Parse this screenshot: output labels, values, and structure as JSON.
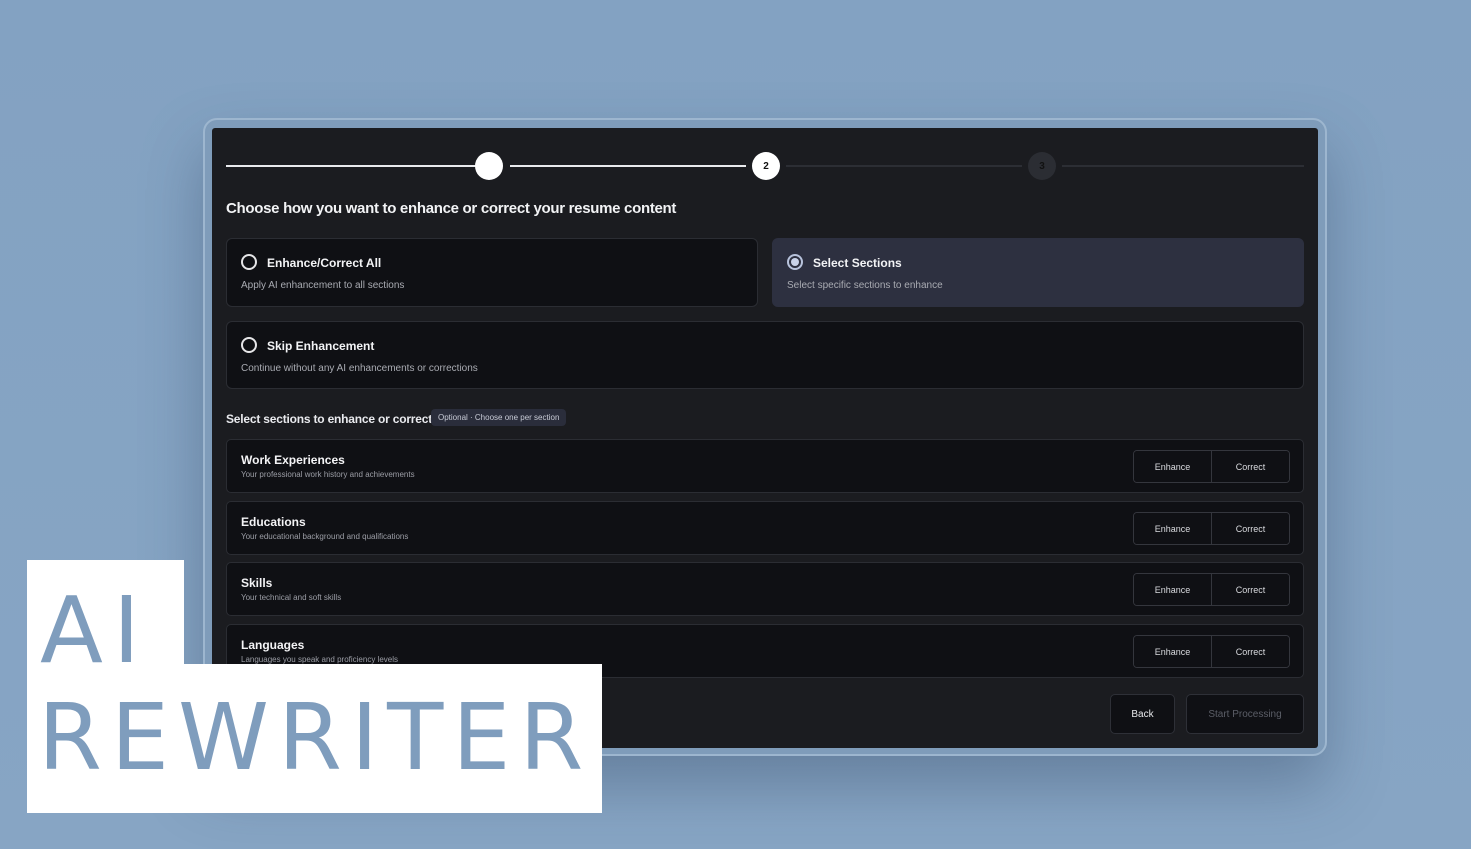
{
  "stepper": {
    "steps": [
      {
        "number": "",
        "state": "complete"
      },
      {
        "number": "2",
        "state": "current"
      },
      {
        "number": "3",
        "state": "upcoming"
      }
    ]
  },
  "heading": "Choose how you want to enhance or correct your resume content",
  "options": [
    {
      "title": "Enhance/Correct All",
      "description": "Apply AI enhancement to all sections",
      "selected": false
    },
    {
      "title": "Select Sections",
      "description": "Select specific sections to enhance",
      "selected": true
    },
    {
      "title": "Skip Enhancement",
      "description": "Continue without any AI enhancements or corrections",
      "selected": false
    }
  ],
  "sections_heading": "Select sections to enhance or correct",
  "sections_badge": "Optional · Choose one per section",
  "sections": [
    {
      "title": "Work Experiences",
      "description": "Your professional work history and achievements",
      "enhance_label": "Enhance",
      "correct_label": "Correct"
    },
    {
      "title": "Educations",
      "description": "Your educational background and qualifications",
      "enhance_label": "Enhance",
      "correct_label": "Correct"
    },
    {
      "title": "Skills",
      "description": "Your technical and soft skills",
      "enhance_label": "Enhance",
      "correct_label": "Correct"
    },
    {
      "title": "Languages",
      "description": "Languages you speak and proficiency levels",
      "enhance_label": "Enhance",
      "correct_label": "Correct"
    }
  ],
  "footer": {
    "back_label": "Back",
    "start_label": "Start Processing"
  },
  "overlay": {
    "line1": "AI",
    "line2": "REWRITER"
  },
  "colors": {
    "background": "#84a3c3",
    "window": "#1b1c20",
    "selected_option": "#2d3040",
    "overlay_text": "#7f9dbd"
  }
}
